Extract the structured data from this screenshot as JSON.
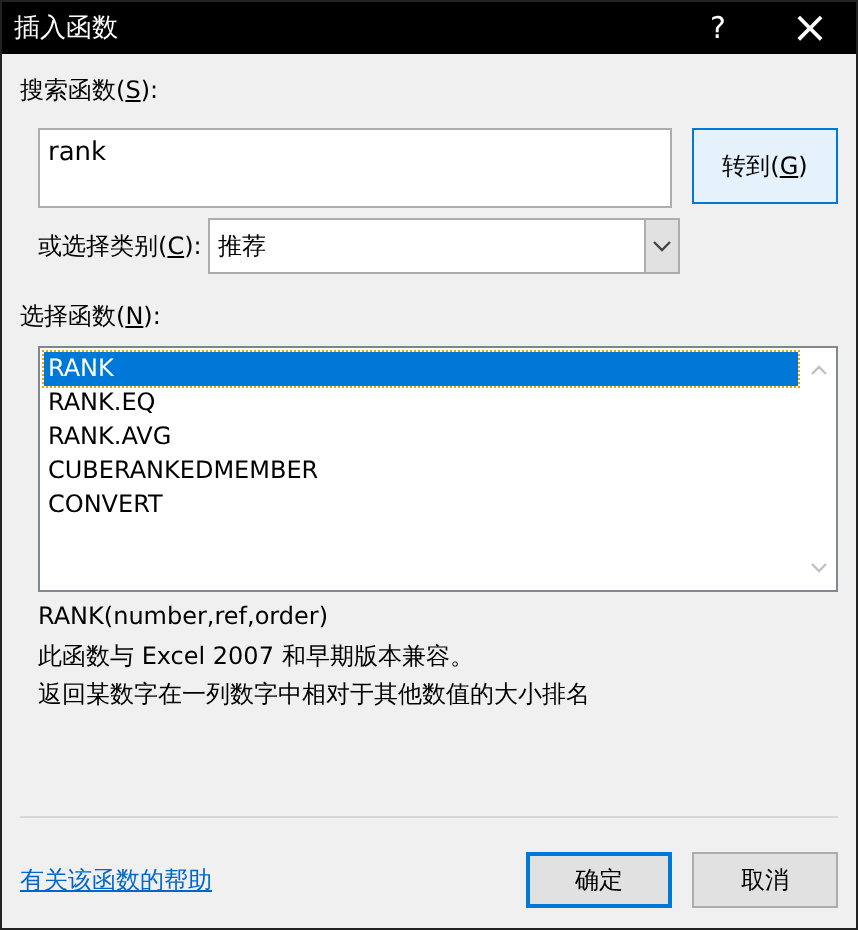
{
  "window": {
    "title": "插入函数",
    "help_button": "?",
    "close_button": "×"
  },
  "search": {
    "label": {
      "before": "搜索函数(",
      "access_key": "S",
      "after": "):"
    },
    "value": "rank",
    "go_button": {
      "label": {
        "before": "转到(",
        "access_key": "G",
        "after": ")"
      }
    }
  },
  "category": {
    "label": {
      "before": "或选择类别(",
      "access_key": "C",
      "after": "):"
    },
    "value": "推荐"
  },
  "functions": {
    "label": {
      "before": "选择函数(",
      "access_key": "N",
      "after": "):"
    },
    "items": [
      {
        "name": "RANK",
        "selected": true
      },
      {
        "name": "RANK.EQ",
        "selected": false
      },
      {
        "name": "RANK.AVG",
        "selected": false
      },
      {
        "name": "CUBERANKEDMEMBER",
        "selected": false
      },
      {
        "name": "CONVERT",
        "selected": false
      }
    ]
  },
  "signature": "RANK(number,ref,order)",
  "description": [
    "此函数与 Excel 2007 和早期版本兼容。",
    "返回某数字在一列数字中相对于其他数值的大小排名"
  ],
  "help_link": "有关该函数的帮助",
  "buttons": [
    {
      "label": "确定",
      "default": true
    },
    {
      "label": "取消",
      "default": false
    }
  ]
}
